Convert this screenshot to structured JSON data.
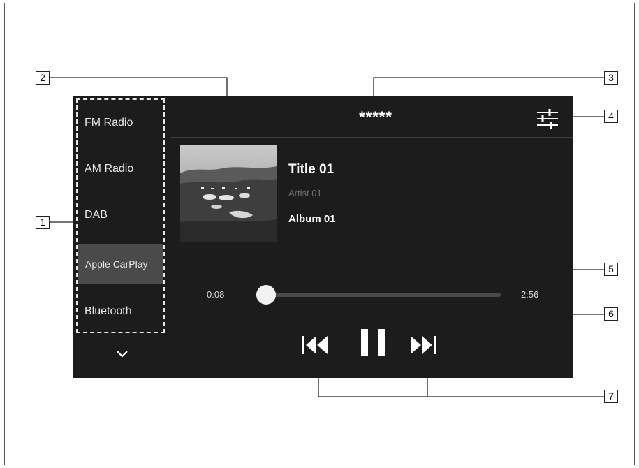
{
  "sources": {
    "items": [
      {
        "label": "FM Radio",
        "selected": false
      },
      {
        "label": "AM Radio",
        "selected": false
      },
      {
        "label": "DAB",
        "selected": false
      },
      {
        "label": "Apple CarPlay",
        "selected": true
      },
      {
        "label": "Bluetooth",
        "selected": false
      }
    ],
    "more_icon": "chevron-down-icon"
  },
  "header": {
    "title": "*****",
    "settings_icon": "sound-settings-icon"
  },
  "track": {
    "title": "Title 01",
    "artist": "Artist 01",
    "album": "Album 01",
    "album_art_icon": "album-art-image"
  },
  "progress": {
    "elapsed": "0:08",
    "remaining": "- 2:56",
    "fraction": 0.044
  },
  "controls": {
    "previous_icon": "skip-previous-icon",
    "pause_icon": "pause-icon",
    "next_icon": "skip-next-icon"
  },
  "callouts": [
    "1",
    "2",
    "3",
    "4",
    "5",
    "6",
    "7"
  ],
  "colors": {
    "screen_bg": "#1c1c1c",
    "selected_bg": "#4a4a4a",
    "text": "#ffffff",
    "dim_text": "#6f6f6f"
  }
}
